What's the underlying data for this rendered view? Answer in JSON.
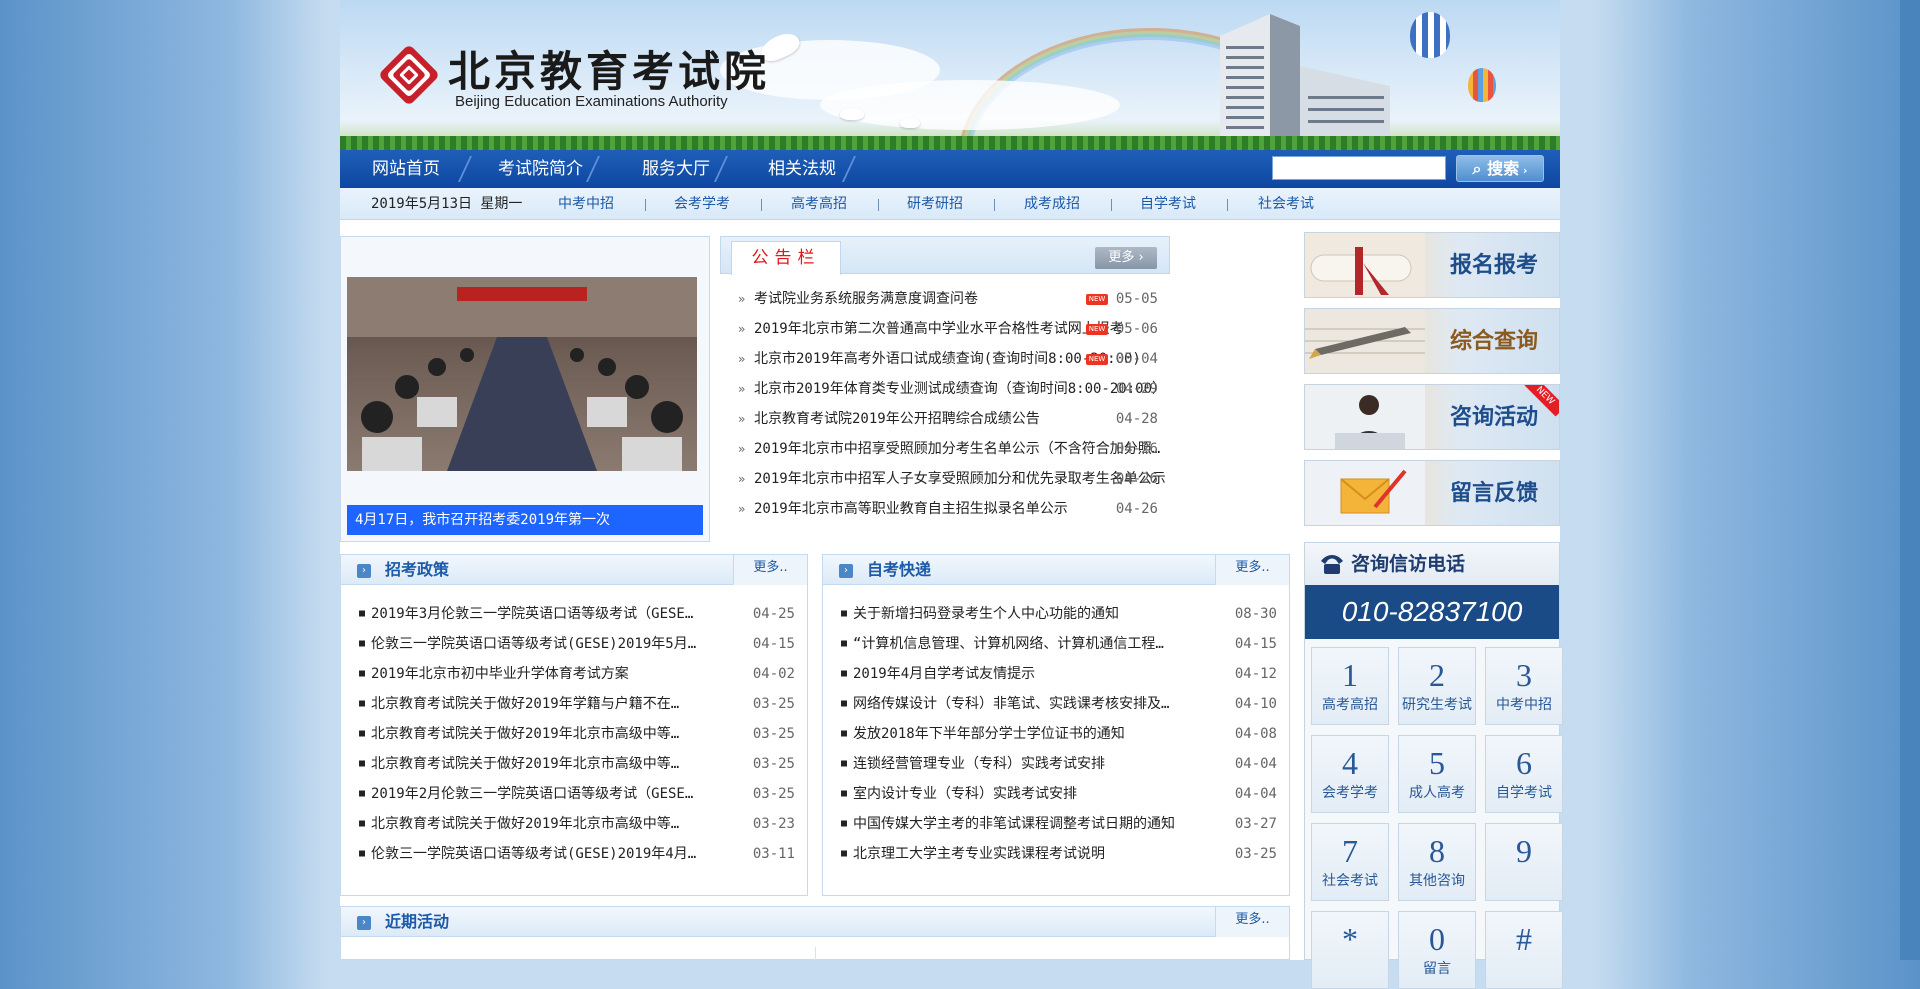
{
  "site": {
    "logo_cn": "北京教育考试院",
    "logo_en": "Beijing Education Examinations Authority"
  },
  "nav": {
    "items": [
      "网站首页",
      "考试院简介",
      "服务大厅",
      "相关法规"
    ],
    "search_placeholder": "",
    "search_button": "搜索"
  },
  "subbar": {
    "date": "2019年5月13日 星期一",
    "links": [
      "中考中招",
      "会考学考",
      "高考高招",
      "研考研招",
      "成考成招",
      "自学考试",
      "社会考试"
    ]
  },
  "slideshow": {
    "caption": "4月17日，我市召开招考委2019年第一次"
  },
  "notice": {
    "title": "公告栏",
    "more": "更多",
    "items": [
      {
        "title": "考试院业务系统服务满意度调查问卷",
        "date": "05-05",
        "new": true
      },
      {
        "title": "2019年北京市第二次普通高中学业水平合格性考试网上报考",
        "date": "05-06",
        "new": true
      },
      {
        "title": "北京市2019年高考外语口试成绩查询(查询时间8:00-20:00)",
        "date": "05-04",
        "new": true
      },
      {
        "title": "北京市2019年体育类专业测试成绩查询（查询时间8:00-20:00）",
        "date": "04-29",
        "new": false
      },
      {
        "title": "北京教育考试院2019年公开招聘综合成绩公告",
        "date": "04-28",
        "new": false
      },
      {
        "title": "2019年北京市中招享受照顾加分考生名单公示（不含符合加分照…",
        "date": "04-26",
        "new": false
      },
      {
        "title": "2019年北京市中招军人子女享受照顾加分和优先录取考生名单公示",
        "date": "04-26",
        "new": false
      },
      {
        "title": "2019年北京市高等职业教育自主招生拟录名单公示",
        "date": "04-26",
        "new": false
      }
    ]
  },
  "policy": {
    "title": "招考政策",
    "more": "更多..",
    "items": [
      {
        "title": "2019年3月伦敦三一学院英语口语等级考试（GESE…",
        "date": "04-25"
      },
      {
        "title": "伦敦三一学院英语口语等级考试(GESE)2019年5月…",
        "date": "04-15"
      },
      {
        "title": "2019年北京市初中毕业升学体育考试方案",
        "date": "04-02"
      },
      {
        "title": "北京教育考试院关于做好2019年学籍与户籍不在…",
        "date": "03-25"
      },
      {
        "title": "北京教育考试院关于做好2019年北京市高级中等…",
        "date": "03-25"
      },
      {
        "title": "北京教育考试院关于做好2019年北京市高级中等…",
        "date": "03-25"
      },
      {
        "title": "2019年2月伦敦三一学院英语口语等级考试（GESE…",
        "date": "03-25"
      },
      {
        "title": "北京教育考试院关于做好2019年北京市高级中等…",
        "date": "03-23"
      },
      {
        "title": "伦敦三一学院英语口语等级考试(GESE)2019年4月…",
        "date": "03-11"
      }
    ]
  },
  "selfexam": {
    "title": "自考快递",
    "more": "更多..",
    "items": [
      {
        "title": "关于新增扫码登录考生个人中心功能的通知",
        "date": "08-30"
      },
      {
        "title": "“计算机信息管理、计算机网络、计算机通信工程…",
        "date": "04-15"
      },
      {
        "title": "2019年4月自学考试友情提示",
        "date": "04-12"
      },
      {
        "title": "网络传媒设计（专科）非笔试、实践课考核安排及…",
        "date": "04-10"
      },
      {
        "title": "发放2018年下半年部分学士学位证书的通知",
        "date": "04-08"
      },
      {
        "title": "连锁经营管理专业（专科）实践考试安排",
        "date": "04-04"
      },
      {
        "title": "室内设计专业（专科）实践考试安排",
        "date": "04-04"
      },
      {
        "title": "中国传媒大学主考的非笔试课程调整考试日期的通知",
        "date": "03-27"
      },
      {
        "title": "北京理工大学主考专业实践课程考试说明",
        "date": "03-25"
      }
    ]
  },
  "activity": {
    "title": "近期活动",
    "more": "更多.."
  },
  "quick": [
    "报名报考",
    "综合查询",
    "咨询活动",
    "留言反馈"
  ],
  "quick_badge": "NEW",
  "phone": {
    "title": "咨询信访电话",
    "number": "010-82837100",
    "keys": [
      {
        "num": "1",
        "label": "高考高招"
      },
      {
        "num": "2",
        "label": "研究生考试"
      },
      {
        "num": "3",
        "label": "中考中招"
      },
      {
        "num": "4",
        "label": "会考学考"
      },
      {
        "num": "5",
        "label": "成人高考"
      },
      {
        "num": "6",
        "label": "自学考试"
      },
      {
        "num": "7",
        "label": "社会考试"
      },
      {
        "num": "8",
        "label": "其他咨询"
      },
      {
        "num": "9",
        "label": ""
      },
      {
        "num": "*",
        "label": ""
      },
      {
        "num": "0",
        "label": "留言"
      },
      {
        "num": "#",
        "label": ""
      }
    ]
  },
  "colors": {
    "nav_bg": "#0d47a1",
    "link": "#1c5aa8",
    "notice_title": "#e0161b",
    "caption_bg": "#1e64ff",
    "phone_bg": "#1a4b86"
  }
}
